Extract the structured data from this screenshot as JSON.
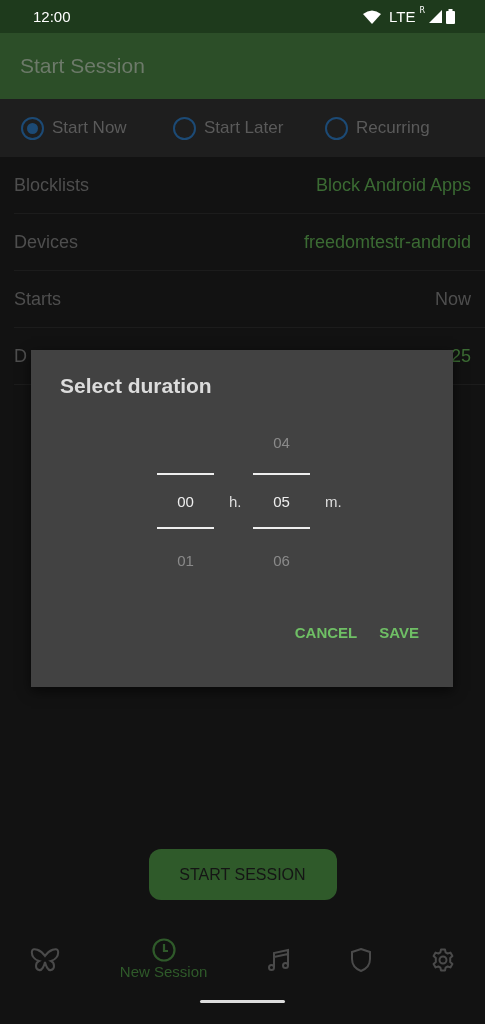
{
  "status_bar": {
    "time": "12:00",
    "network": "LTE",
    "roaming": "R"
  },
  "app_bar": {
    "title": "Start Session"
  },
  "modes": [
    {
      "label": "Start Now",
      "selected": true
    },
    {
      "label": "Start Later",
      "selected": false
    },
    {
      "label": "Recurring",
      "selected": false
    }
  ],
  "settings": [
    {
      "label": "Blocklists",
      "value": "Block Android Apps",
      "accent": true
    },
    {
      "label": "Devices",
      "value": "freedomtestr-android",
      "accent": true
    },
    {
      "label": "Starts",
      "value": "Now",
      "accent": false
    },
    {
      "label": "D",
      "value": "25",
      "accent": true
    }
  ],
  "dialog": {
    "title": "Select duration",
    "pickers": [
      {
        "selected": "00",
        "below": "01",
        "unit": "h."
      },
      {
        "above": "04",
        "selected": "05",
        "below": "06",
        "unit": "m."
      }
    ],
    "buttons": [
      "CANCEL",
      "SAVE"
    ]
  },
  "start_button": "START SESSION",
  "nav": [
    {
      "kind": "butterfly",
      "selected": false
    },
    {
      "kind": "clock",
      "label": "New Session",
      "selected": true
    },
    {
      "kind": "music",
      "selected": false
    },
    {
      "kind": "shield",
      "selected": false
    },
    {
      "kind": "settings",
      "selected": false
    }
  ]
}
